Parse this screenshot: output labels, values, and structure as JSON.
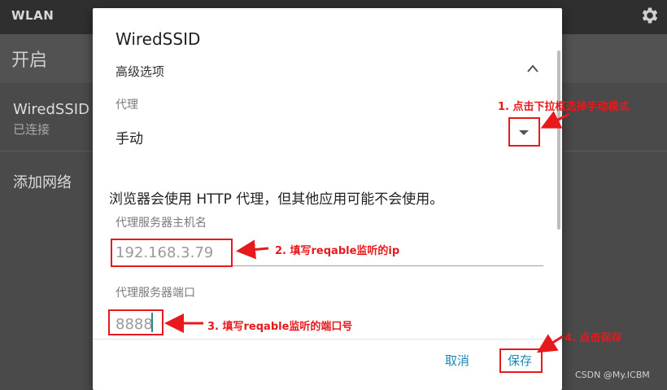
{
  "background": {
    "app_title": "WLAN",
    "switch_label": "开启",
    "network_name": "WiredSSID",
    "network_status": "已连接",
    "add_network": "添加网络",
    "settings_icon": "gear-icon"
  },
  "dialog": {
    "title": "WiredSSID",
    "advanced_options": "高级选项",
    "collapse_icon": "chevron-up-icon",
    "proxy_label": "代理",
    "proxy_value": "手动",
    "proxy_note": "浏览器会使用 HTTP 代理，但其他应用可能不会使用。",
    "host_label": "代理服务器主机名",
    "host_value": "192.168.3.79",
    "port_label": "代理服务器端口",
    "port_value": "8888",
    "cancel_button": "取消",
    "save_button": "保存"
  },
  "annotations": {
    "step1": "1. 点击下拉框选择手动模式",
    "step2": "2. 填写reqable监听的ip",
    "step3": "3. 填写reqable监听的端口号",
    "step4": "4. 点击保存",
    "color": "#e8191c"
  },
  "watermark": "CSDN @My.ICBM",
  "colors": {
    "accent": "#1e88b4",
    "cursor": "#2a8a86"
  }
}
